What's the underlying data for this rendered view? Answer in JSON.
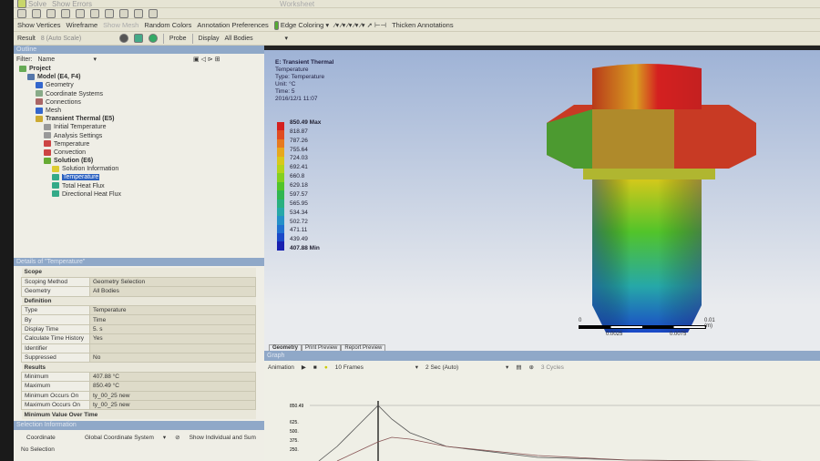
{
  "toolbar1": {
    "solve": "Solve",
    "show_errors": "Show Errors",
    "worksheet": "Worksheet"
  },
  "toolbar2": {
    "show_vertices": "Show Vertices",
    "wireframe": "Wireframe",
    "show_mesh": "Show Mesh",
    "random_colors": "Random Colors",
    "annotation_preferences": "Annotation Preferences",
    "edge_coloring": "Edge Coloring",
    "thicken_annotations": "Thicken Annotations"
  },
  "toolbar3": {
    "result_label": "Result",
    "scale": "8 (Auto Scale)",
    "probe": "Probe",
    "display_label": "Display",
    "display_value": "All Bodies"
  },
  "outline": {
    "title": "Outline",
    "filter_label": "Filter:",
    "filter_value": "Name",
    "items": [
      {
        "label": "Project",
        "level": 0,
        "bold": true,
        "color": "#6a5"
      },
      {
        "label": "Model (E4, F4)",
        "level": 1,
        "bold": true,
        "color": "#57a"
      },
      {
        "label": "Geometry",
        "level": 2,
        "color": "#36c"
      },
      {
        "label": "Coordinate Systems",
        "level": 2,
        "color": "#8a8"
      },
      {
        "label": "Connections",
        "level": 2,
        "color": "#a66"
      },
      {
        "label": "Mesh",
        "level": 2,
        "color": "#36c"
      },
      {
        "label": "Transient Thermal (E5)",
        "level": 2,
        "bold": true,
        "color": "#ca3"
      },
      {
        "label": "Initial Temperature",
        "level": 3,
        "color": "#999"
      },
      {
        "label": "Analysis Settings",
        "level": 3,
        "color": "#999"
      },
      {
        "label": "Temperature",
        "level": 3,
        "color": "#c44"
      },
      {
        "label": "Convection",
        "level": 3,
        "color": "#c44"
      },
      {
        "label": "Solution (E6)",
        "level": 3,
        "bold": true,
        "color": "#6a3"
      },
      {
        "label": "Solution Information",
        "level": 4,
        "color": "#dc3"
      },
      {
        "label": "Temperature",
        "level": 4,
        "selected": true,
        "color": "#3a8"
      },
      {
        "label": "Total Heat Flux",
        "level": 4,
        "color": "#3a8"
      },
      {
        "label": "Directional Heat Flux",
        "level": 4,
        "color": "#3a8"
      }
    ]
  },
  "details": {
    "title": "Details of \"Temperature\"",
    "rows": [
      {
        "group": "Scope"
      },
      {
        "k": "Scoping Method",
        "v": "Geometry Selection"
      },
      {
        "k": "Geometry",
        "v": "All Bodies"
      },
      {
        "group": "Definition"
      },
      {
        "k": "Type",
        "v": "Temperature"
      },
      {
        "k": "By",
        "v": "Time"
      },
      {
        "k": "Display Time",
        "v": "5. s"
      },
      {
        "k": "Calculate Time History",
        "v": "Yes"
      },
      {
        "k": "Identifier",
        "v": ""
      },
      {
        "k": "Suppressed",
        "v": "No"
      },
      {
        "group": "Results"
      },
      {
        "k": "Minimum",
        "v": "407.88 °C"
      },
      {
        "k": "Maximum",
        "v": "850.49 °C"
      },
      {
        "k": "Minimum Occurs On",
        "v": "ty_00_25 new"
      },
      {
        "k": "Maximum Occurs On",
        "v": "ty_00_25 new"
      },
      {
        "group": "Minimum Value Over Time"
      }
    ]
  },
  "selection": {
    "title": "Selection Information",
    "coordinate_label": "Coordinate",
    "coordinate_value": "Global Coordinate System",
    "show_label": "Show Individual and Sum",
    "status": "No Selection"
  },
  "viewport": {
    "title": "E: Transient Thermal",
    "lines": [
      "Temperature",
      "Type: Temperature",
      "Unit: °C",
      "Time: 5",
      "2016/12/1 11:07"
    ],
    "legend": [
      "850.49 Max",
      "818.87",
      "787.26",
      "755.64",
      "724.03",
      "692.41",
      "660.8",
      "629.18",
      "597.57",
      "565.95",
      "534.34",
      "502.72",
      "471.11",
      "439.49",
      "407.88 Min"
    ],
    "legend_colors": [
      "#d42020",
      "#e04c20",
      "#e77a1e",
      "#e7a81c",
      "#d8c81a",
      "#b4d41a",
      "#84d020",
      "#52c42a",
      "#30b650",
      "#28b080",
      "#26a8a8",
      "#2490c8",
      "#2070d0",
      "#1a48c8",
      "#1820b0"
    ],
    "scale": {
      "a": "0",
      "b": "0.01 (m)",
      "c": "0.0025",
      "d": "0.0075"
    },
    "tabs": [
      "Geometry",
      "Print Preview",
      "Report Preview"
    ]
  },
  "graph": {
    "title": "Graph",
    "animation": "Animation",
    "frames": "10 Frames",
    "speed": "2 Sec (Auto)",
    "cycles": "3 Cycles",
    "y_ticks": [
      "850.49",
      "625.",
      "500.",
      "375.",
      "250."
    ]
  }
}
